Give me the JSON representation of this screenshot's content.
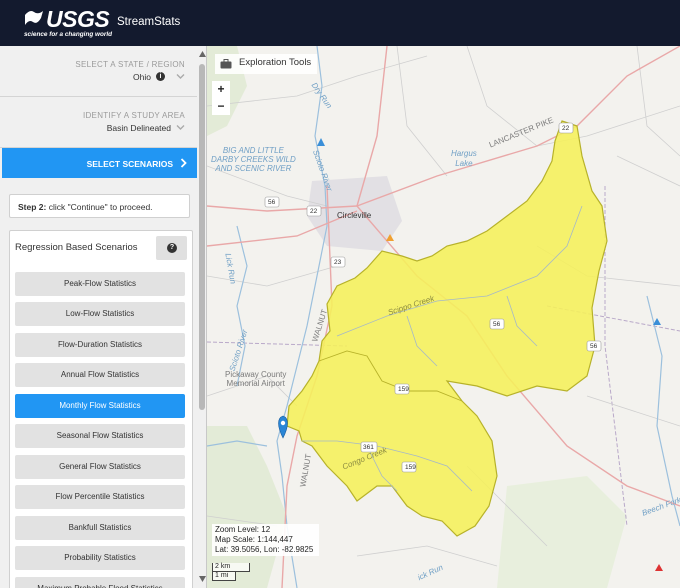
{
  "header": {
    "logo_text": "USGS",
    "logo_tagline": "science for a changing world",
    "app_title": "StreamStats"
  },
  "sidebar": {
    "state_step": {
      "label": "SELECT A STATE / REGION",
      "value": "Ohio"
    },
    "study_area_step": {
      "label": "IDENTIFY A STUDY AREA",
      "value": "Basin Delineated"
    },
    "scenarios_step": {
      "label": "SELECT SCENARIOS"
    },
    "instruction": {
      "prefix": "Step 2:",
      "text": " click \"Continue\" to proceed."
    },
    "regression_panel": {
      "title": "Regression Based Scenarios",
      "buttons": [
        {
          "label": "Peak-Flow Statistics",
          "active": false
        },
        {
          "label": "Low-Flow Statistics",
          "active": false
        },
        {
          "label": "Flow-Duration Statistics",
          "active": false
        },
        {
          "label": "Annual Flow Statistics",
          "active": false
        },
        {
          "label": "Monthly Flow Statistics",
          "active": true
        },
        {
          "label": "Seasonal Flow Statistics",
          "active": false
        },
        {
          "label": "General Flow Statistics",
          "active": false
        },
        {
          "label": "Flow Percentile Statistics",
          "active": false
        },
        {
          "label": "Bankfull Statistics",
          "active": false
        },
        {
          "label": "Probability Statistics",
          "active": false
        },
        {
          "label": "Maximum Probable Flood Statistics",
          "active": false
        }
      ]
    }
  },
  "map": {
    "exploration_tools_label": "Exploration Tools",
    "zoom_in": "+",
    "zoom_out": "−",
    "info": {
      "zoom_level": "Zoom Level: 12",
      "map_scale": "Map Scale: 1:144,447",
      "lat_lon": "Lat: 39.5056, Lon: -82.9825"
    },
    "scale_km": "2 km",
    "scale_mi": "1 mi",
    "labels": {
      "dry_run": "Dry Run",
      "scioto_river_n": "Scioto River",
      "big_little_darby": "BIG AND LITTLE\nDARBY CREEKS WILD\nAND SCENIC RIVER",
      "hargus_lake": "Hargus\nLake",
      "lancaster_pike": "LANCASTER PIKE",
      "circleville": "Circleville",
      "lick_run": "Lick Run",
      "scippo_creek": "Scippo Creek",
      "scioto_river_s": "Scioto River",
      "walnut_n": "WALNUT",
      "walnut_s": "WALNUT",
      "pickaway_airport": "Pickaway County\nMemorial Airport",
      "congo_creek": "Congo Creek",
      "beech_fork": "Beech Fork",
      "lick_run_s": "ick Run",
      "route_56": "56",
      "route_22": "22",
      "route_23": "23",
      "route_56b": "56",
      "route_361": "361",
      "route_159": "159",
      "route_22e": "22",
      "route_56e": "56",
      "route_159w": "159"
    }
  },
  "colors": {
    "header_bg": "#131a2e",
    "accent": "#2196f3",
    "basin_fill": "#f5f05a",
    "basin_stroke": "#b7b22a"
  }
}
